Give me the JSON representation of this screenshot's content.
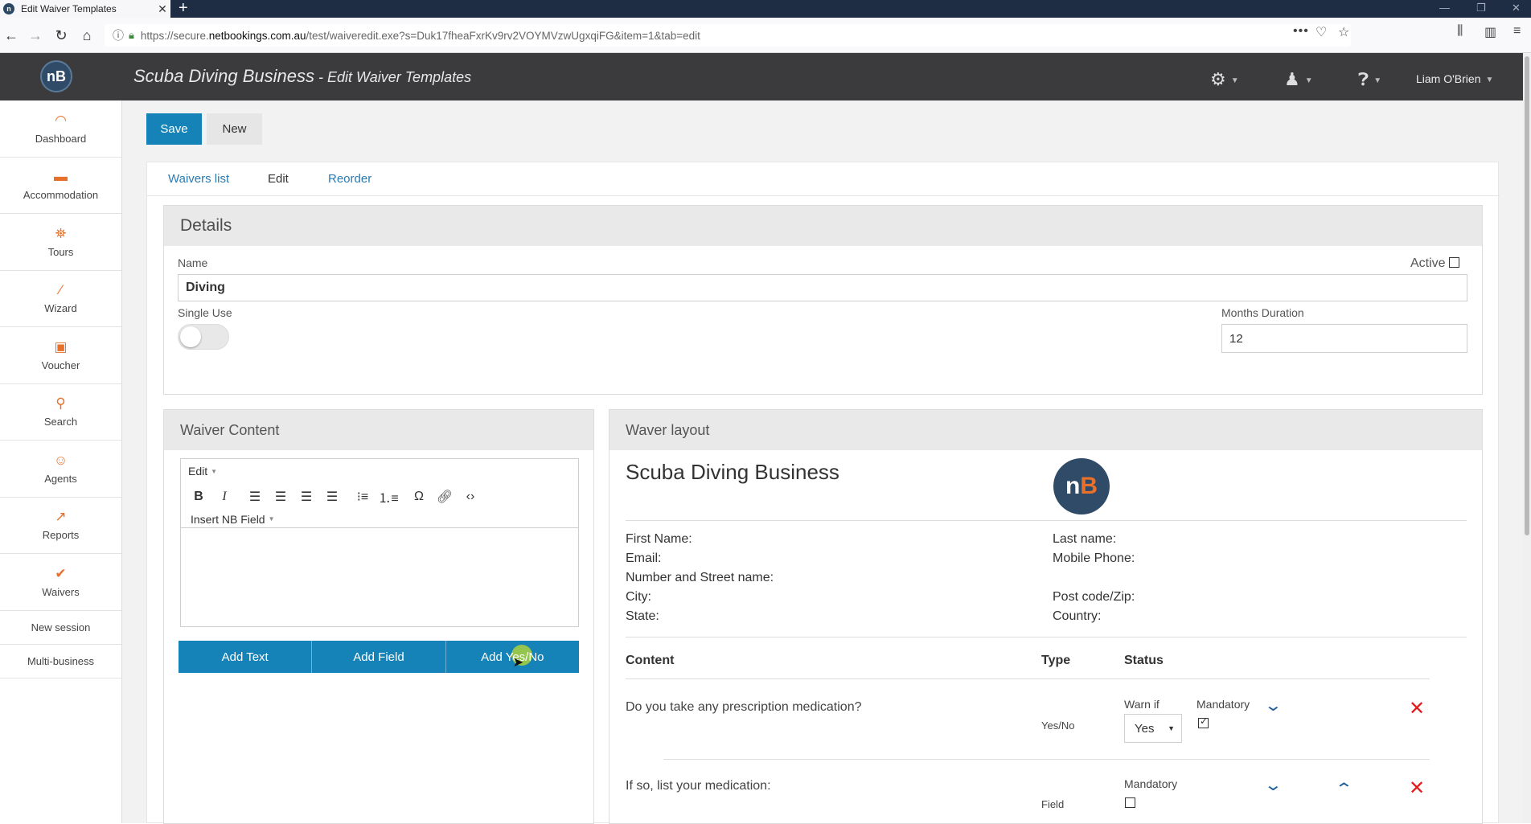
{
  "browser": {
    "tab_title": "Edit Waiver Templates",
    "favicon": "n",
    "url_prefix": "https://secure.",
    "url_domain": "netbookings.com.au",
    "url_rest": "/test/waiveredit.exe?s=Duk17fheaFxrKv9rv2VOYMVzwUgxqiFG&item=1&tab=edit",
    "page_actions_icon": "•••"
  },
  "app": {
    "logo": "nB",
    "business": "Scuba Diving Business",
    "separator": " - ",
    "page": "Edit Waiver Templates",
    "user": "Liam O'Brien"
  },
  "sidebar": {
    "items": [
      {
        "label": "Dashboard",
        "icon": "◠"
      },
      {
        "label": "Accommodation",
        "icon": "▬"
      },
      {
        "label": "Tours",
        "icon": "⛯"
      },
      {
        "label": "Wizard",
        "icon": "⁄"
      },
      {
        "label": "Voucher",
        "icon": "▣"
      },
      {
        "label": "Search",
        "icon": "⚲"
      },
      {
        "label": "Agents",
        "icon": "☺"
      },
      {
        "label": "Reports",
        "icon": "↗"
      },
      {
        "label": "Waivers",
        "icon": "✔"
      }
    ],
    "links": [
      "New session",
      "Multi-business"
    ]
  },
  "toolbar": {
    "save": "Save",
    "new": "New"
  },
  "tabs": {
    "list": "Waivers list",
    "edit": "Edit",
    "reorder": "Reorder"
  },
  "details": {
    "heading": "Details",
    "name_label": "Name",
    "name_value": "Diving",
    "active_label": "Active",
    "single_use_label": "Single Use",
    "months_label": "Months Duration",
    "months_value": "12"
  },
  "content": {
    "heading": "Waiver Content",
    "menu_edit": "Edit",
    "insert_field": "Insert NB Field",
    "add_text": "Add Text",
    "add_field": "Add Field",
    "add_yesno": "Add Yes/No"
  },
  "layout": {
    "heading": "Waver layout",
    "business": "Scuba Diving Business",
    "logo_n": "n",
    "logo_b": "B",
    "fields_left": [
      "First Name:",
      "Email:",
      "Number and Street name:",
      "City:",
      "State:"
    ],
    "fields_right": [
      "Last name:",
      "Mobile Phone:",
      "",
      "Post code/Zip:",
      "Country:"
    ],
    "col_content": "Content",
    "col_type": "Type",
    "col_status": "Status",
    "rows": [
      {
        "question": "Do you take any prescription medication?",
        "type": "Yes/No",
        "warn_label": "Warn if",
        "warn_value": "Yes",
        "mandatory_label": "Mandatory"
      },
      {
        "question": "If so, list your medication:",
        "type": "Field",
        "mandatory_label": "Mandatory"
      }
    ]
  },
  "colors": {
    "accent": "#1583b8",
    "brand_orange": "#e8702a",
    "header_bg": "#3b3b3d",
    "delete": "#e31b1b"
  }
}
